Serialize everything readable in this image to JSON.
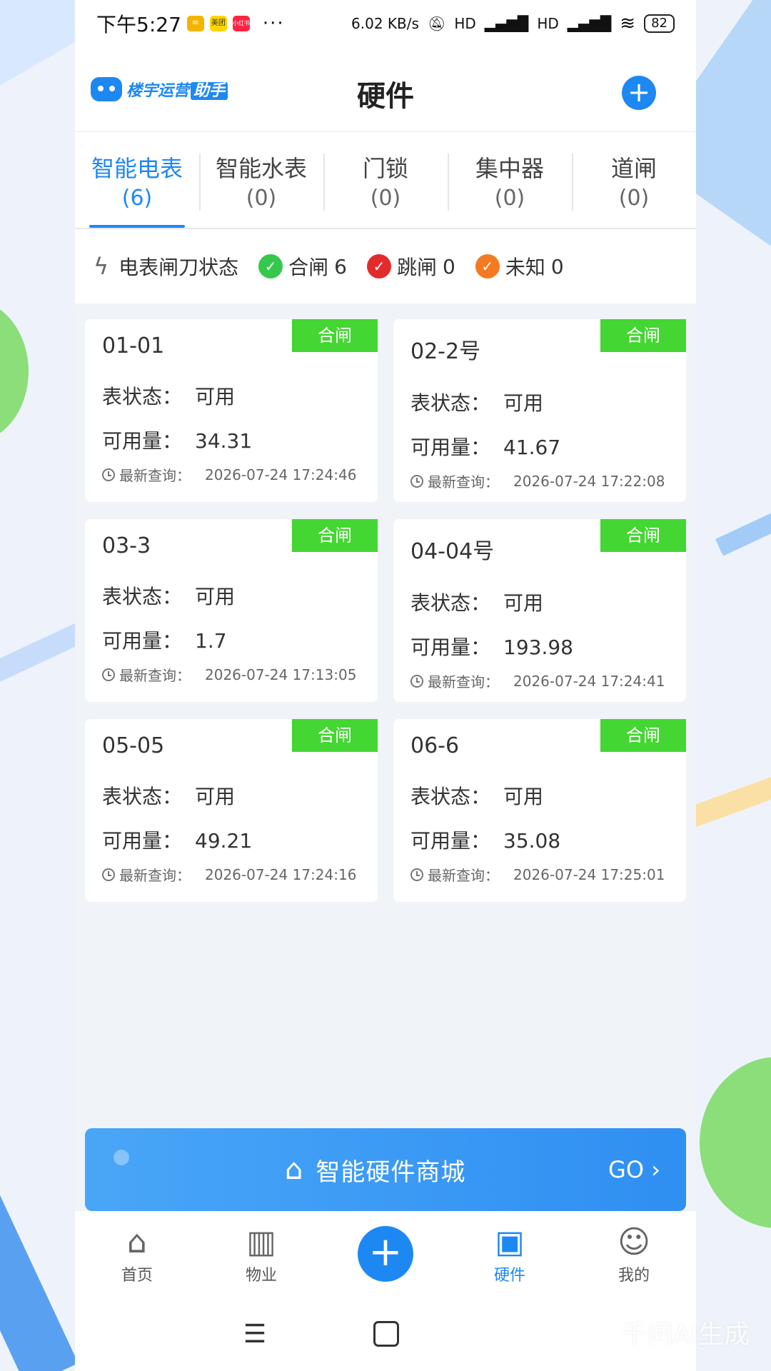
{
  "status_bar": {
    "time": "下午5:27",
    "app_icons": [
      "mail",
      "美团",
      "小红书"
    ],
    "more": "···",
    "net_speed": "6.02 KB/s",
    "hd1": "HD",
    "hd2": "HD",
    "battery": "82"
  },
  "header": {
    "logo_text": "楼宇运营",
    "logo_highlight": "助手",
    "title": "硬件",
    "add_icon": "+"
  },
  "tabs": [
    {
      "label": "智能电表",
      "count": "(6)"
    },
    {
      "label": "智能水表",
      "count": "(0)"
    },
    {
      "label": "门锁",
      "count": "(0)"
    },
    {
      "label": "集中器",
      "count": "(0)"
    },
    {
      "label": "道闸",
      "count": "(0)"
    }
  ],
  "gate_status": {
    "bolt_icon": "ϟ",
    "label": "电表闸刀状态",
    "closed": {
      "label": "合闸",
      "count": "6"
    },
    "tripped": {
      "label": "跳闸",
      "count": "0"
    },
    "unknown": {
      "label": "未知",
      "count": "0"
    }
  },
  "card_labels": {
    "state": "表状态：",
    "available": "可用量：",
    "query": "最新查询："
  },
  "meters": [
    {
      "name": "01-01",
      "badge": "合闸",
      "state": "可用",
      "available": "34.31",
      "query_time": "2026-07-24 17:24:46"
    },
    {
      "name": "02-2号",
      "badge": "合闸",
      "state": "可用",
      "available": "41.67",
      "query_time": "2026-07-24 17:22:08"
    },
    {
      "name": "03-3",
      "badge": "合闸",
      "state": "可用",
      "available": "1.7",
      "query_time": "2026-07-24 17:13:05"
    },
    {
      "name": "04-04号",
      "badge": "合闸",
      "state": "可用",
      "available": "193.98",
      "query_time": "2026-07-24 17:24:41"
    },
    {
      "name": "05-05",
      "badge": "合闸",
      "state": "可用",
      "available": "49.21",
      "query_time": "2026-07-24 17:24:16"
    },
    {
      "name": "06-6",
      "badge": "合闸",
      "state": "可用",
      "available": "35.08",
      "query_time": "2026-07-24 17:25:01"
    }
  ],
  "mall": {
    "label": "智能硬件商城",
    "go": "GO ›",
    "icon": "store-icon"
  },
  "nav": [
    {
      "label": "首页",
      "icon": "⌂"
    },
    {
      "label": "物业",
      "icon": "▥"
    },
    {
      "label": "硬件",
      "icon": "▣"
    },
    {
      "label": "我的",
      "icon": "☺"
    }
  ],
  "nav_plus": "+",
  "watermark": "千问AI生成",
  "colors": {
    "accent": "#1e88f2",
    "badge_green": "#44d632"
  }
}
